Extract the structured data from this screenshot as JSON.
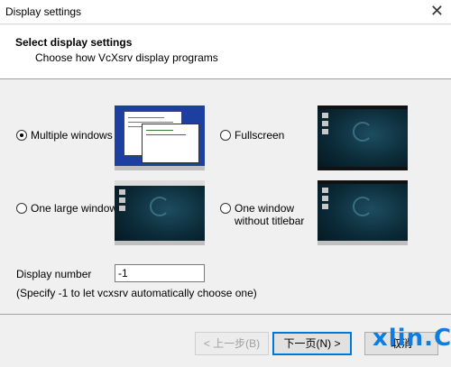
{
  "window": {
    "title": "Display settings",
    "close_glyph": "✕"
  },
  "header": {
    "title": "Select display settings",
    "subtitle": "Choose how VcXsrv display programs"
  },
  "options": {
    "multiple": {
      "label": "Multiple windows",
      "selected": true
    },
    "fullscreen": {
      "label": "Fullscreen",
      "selected": false
    },
    "one_large": {
      "label": "One large window",
      "selected": false
    },
    "no_titlebar": {
      "label_line1": "One window",
      "label_line2": "without titlebar",
      "selected": false
    }
  },
  "display_number": {
    "label": "Display number",
    "value": "-1",
    "hint": "(Specify -1 to let vcxsrv automatically choose one)"
  },
  "buttons": {
    "back": "< 上一步(B)",
    "next": "下一页(N) >",
    "cancel": "取消"
  },
  "watermark": "xlin.Cn",
  "colors": {
    "accent": "#0078d7",
    "watermark": "#0d7de0",
    "desktop": "#0b2a37",
    "multi_bg": "#1d3fa0"
  }
}
